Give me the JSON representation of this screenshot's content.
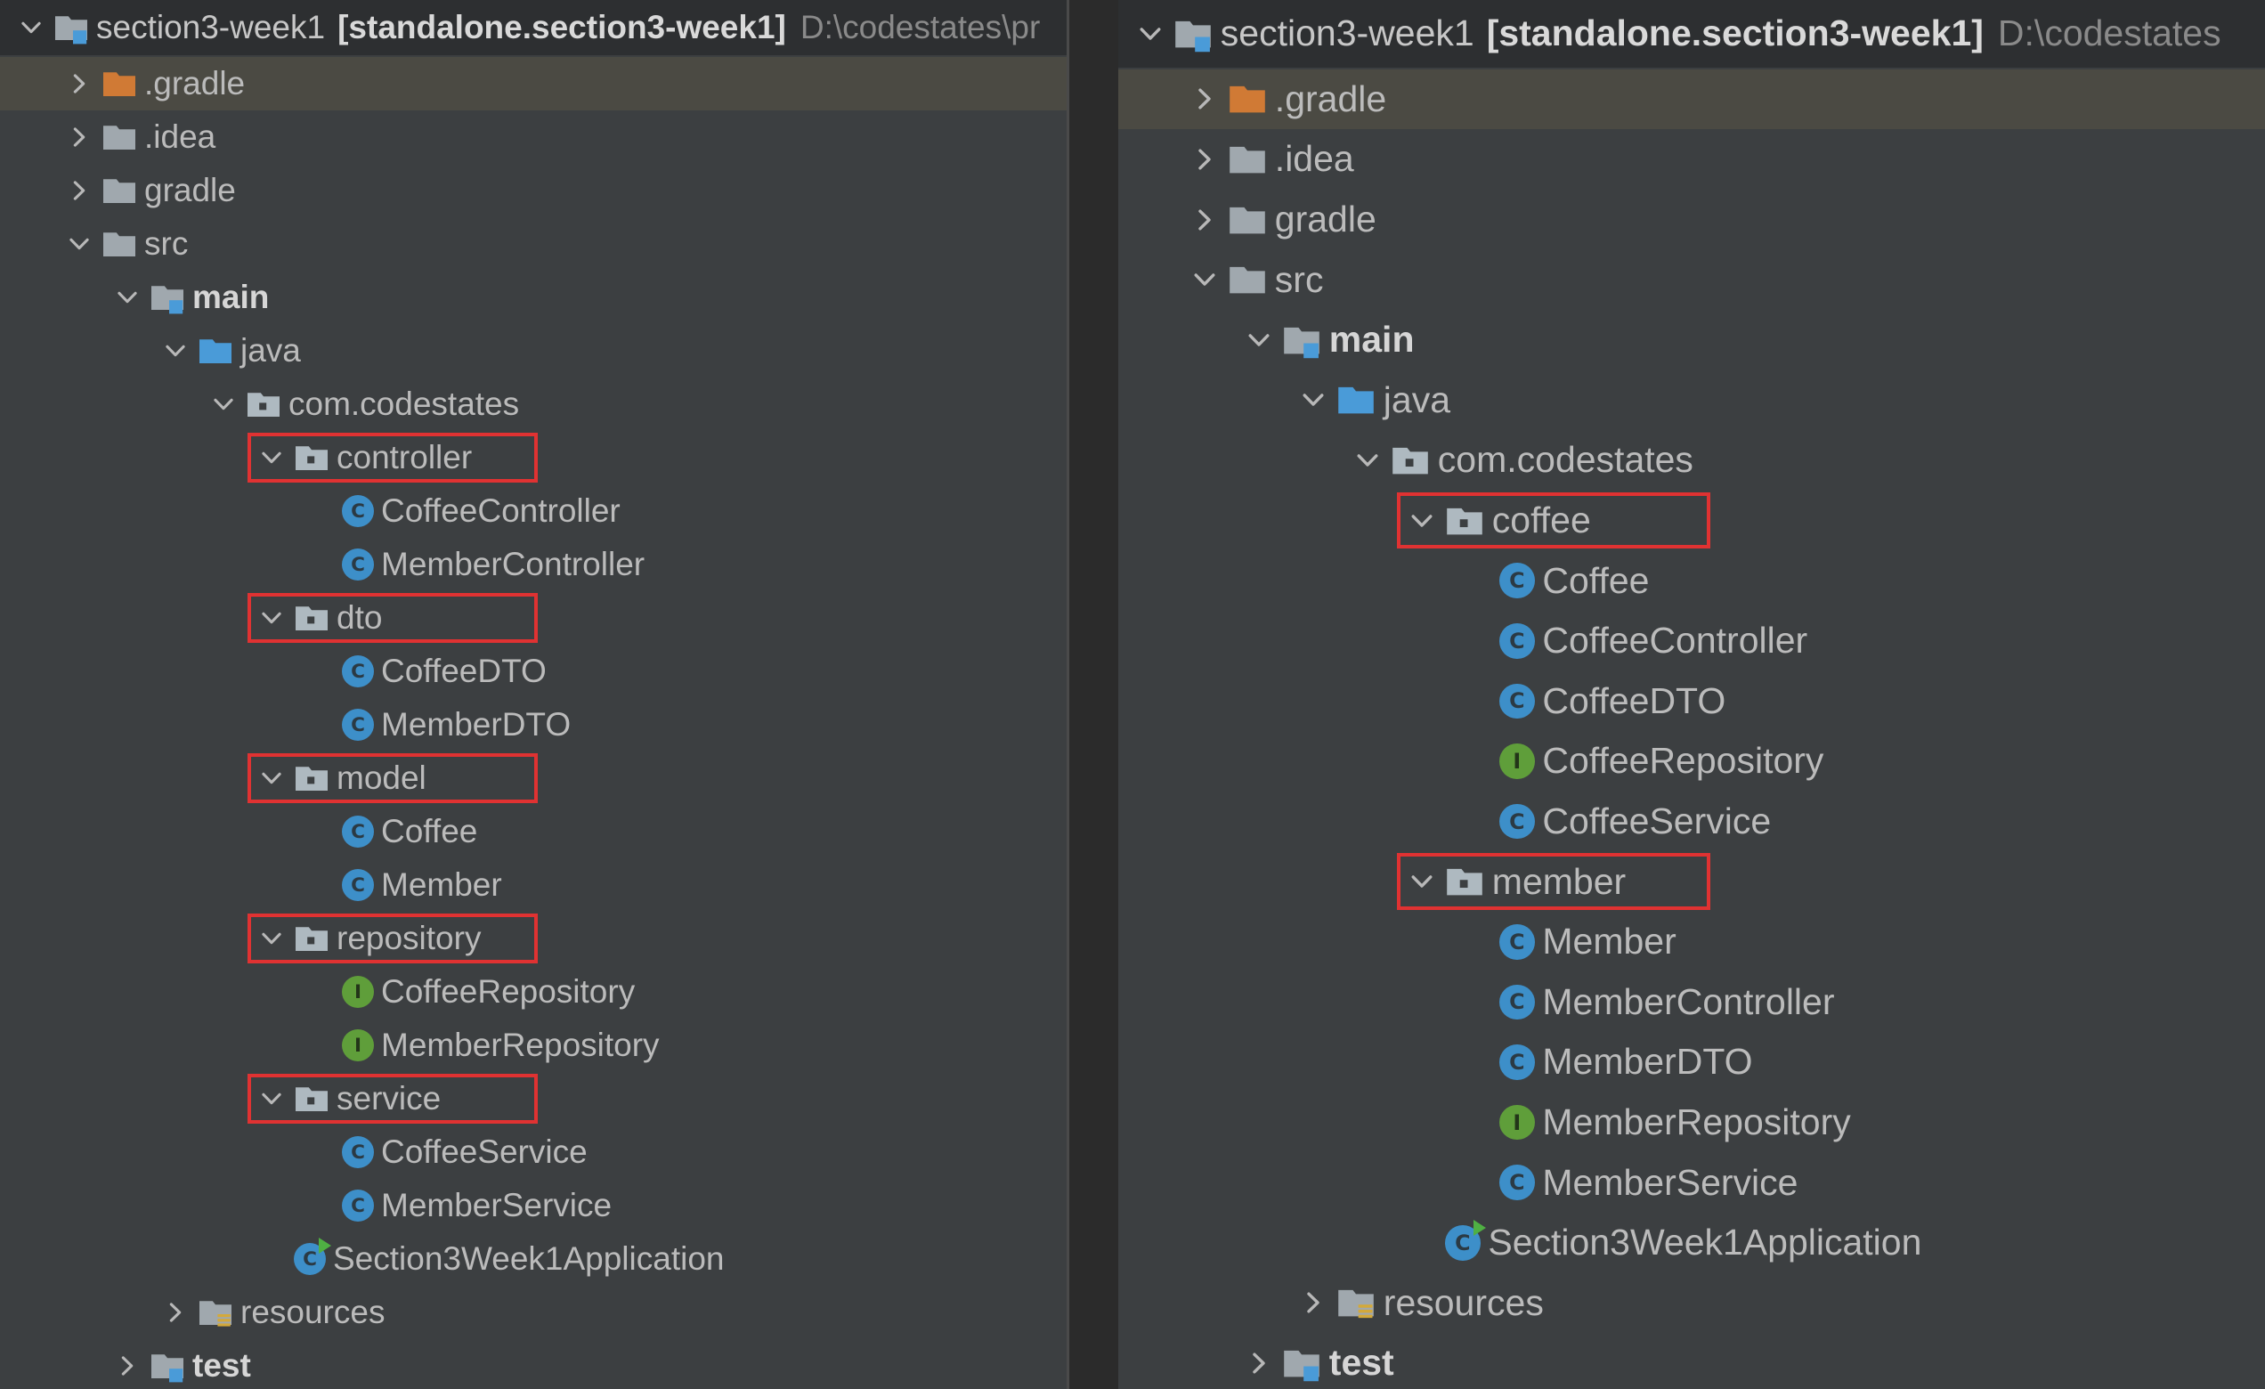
{
  "colors": {
    "panel_bg": "#3c3f41",
    "header_bg": "#2d2f31",
    "selected_row": "#4b4a43",
    "text": "#bbbbbb",
    "class_icon": "#3d8fc9",
    "interface_icon": "#5f9e3a",
    "gradle_folder": "#d07a35",
    "package_folder": "#aeb9c0",
    "source_folder": "#4a9bd8",
    "highlight_box": "#e03232"
  },
  "left": {
    "rows": [
      {
        "depth": 0,
        "chev": "down",
        "icon": "module-folder",
        "label": "section3-week1",
        "bold_suffix": "[standalone.section3-week1]",
        "path": "D:\\codestates\\pr",
        "header": true
      },
      {
        "depth": 1,
        "chev": "right",
        "icon": "gradle-folder-icon",
        "label": ".gradle",
        "hl": true
      },
      {
        "depth": 1,
        "chev": "right",
        "icon": "folder-icon",
        "label": ".idea"
      },
      {
        "depth": 1,
        "chev": "right",
        "icon": "folder-icon",
        "label": "gradle"
      },
      {
        "depth": 1,
        "chev": "down",
        "icon": "folder-icon",
        "label": "src"
      },
      {
        "depth": 2,
        "chev": "down",
        "icon": "module-folder-icon",
        "label": "main",
        "bold": true
      },
      {
        "depth": 3,
        "chev": "down",
        "icon": "source-folder-icon",
        "label": "java"
      },
      {
        "depth": 4,
        "chev": "down",
        "icon": "package-icon",
        "label": "com.codestates"
      },
      {
        "depth": 5,
        "chev": "down",
        "icon": "package-icon",
        "label": "controller",
        "box": true
      },
      {
        "depth": 6,
        "icon": "class-icon",
        "label": "CoffeeController"
      },
      {
        "depth": 6,
        "icon": "class-icon",
        "label": "MemberController"
      },
      {
        "depth": 5,
        "chev": "down",
        "icon": "package-icon",
        "label": "dto",
        "box": true
      },
      {
        "depth": 6,
        "icon": "class-icon",
        "label": "CoffeeDTO"
      },
      {
        "depth": 6,
        "icon": "class-icon",
        "label": "MemberDTO"
      },
      {
        "depth": 5,
        "chev": "down",
        "icon": "package-icon",
        "label": "model",
        "box": true
      },
      {
        "depth": 6,
        "icon": "class-icon",
        "label": "Coffee"
      },
      {
        "depth": 6,
        "icon": "class-icon",
        "label": "Member"
      },
      {
        "depth": 5,
        "chev": "down",
        "icon": "package-icon",
        "label": "repository",
        "box": true
      },
      {
        "depth": 6,
        "icon": "interface-icon",
        "label": "CoffeeRepository"
      },
      {
        "depth": 6,
        "icon": "interface-icon",
        "label": "MemberRepository"
      },
      {
        "depth": 5,
        "chev": "down",
        "icon": "package-icon",
        "label": "service",
        "box": true
      },
      {
        "depth": 6,
        "icon": "class-icon",
        "label": "CoffeeService"
      },
      {
        "depth": 6,
        "icon": "class-icon",
        "label": "MemberService"
      },
      {
        "depth": 5,
        "icon": "spring-app-icon",
        "label": "Section3Week1Application"
      },
      {
        "depth": 3,
        "chev": "right",
        "icon": "resources-folder-icon",
        "label": "resources"
      },
      {
        "depth": 2,
        "chev": "right",
        "icon": "module-folder-icon",
        "label": "test",
        "bold": true
      }
    ]
  },
  "right": {
    "rows": [
      {
        "depth": 0,
        "chev": "down",
        "icon": "module-folder",
        "label": "section3-week1",
        "bold_suffix": "[standalone.section3-week1]",
        "path": "D:\\codestates",
        "header": true
      },
      {
        "depth": 1,
        "chev": "right",
        "icon": "gradle-folder-icon",
        "label": ".gradle",
        "hl": true
      },
      {
        "depth": 1,
        "chev": "right",
        "icon": "folder-icon",
        "label": ".idea"
      },
      {
        "depth": 1,
        "chev": "right",
        "icon": "folder-icon",
        "label": "gradle"
      },
      {
        "depth": 1,
        "chev": "down",
        "icon": "folder-icon",
        "label": "src"
      },
      {
        "depth": 2,
        "chev": "down",
        "icon": "module-folder-icon",
        "label": "main",
        "bold": true
      },
      {
        "depth": 3,
        "chev": "down",
        "icon": "source-folder-icon",
        "label": "java"
      },
      {
        "depth": 4,
        "chev": "down",
        "icon": "package-icon",
        "label": "com.codestates"
      },
      {
        "depth": 5,
        "chev": "down",
        "icon": "package-icon",
        "label": "coffee",
        "box": true
      },
      {
        "depth": 6,
        "icon": "class-icon",
        "label": "Coffee"
      },
      {
        "depth": 6,
        "icon": "class-icon",
        "label": "CoffeeController"
      },
      {
        "depth": 6,
        "icon": "class-icon",
        "label": "CoffeeDTO"
      },
      {
        "depth": 6,
        "icon": "interface-icon",
        "label": "CoffeeRepository"
      },
      {
        "depth": 6,
        "icon": "class-icon",
        "label": "CoffeeService"
      },
      {
        "depth": 5,
        "chev": "down",
        "icon": "package-icon",
        "label": "member",
        "box": true
      },
      {
        "depth": 6,
        "icon": "class-icon",
        "label": "Member"
      },
      {
        "depth": 6,
        "icon": "class-icon",
        "label": "MemberController"
      },
      {
        "depth": 6,
        "icon": "class-icon",
        "label": "MemberDTO"
      },
      {
        "depth": 6,
        "icon": "interface-icon",
        "label": "MemberRepository"
      },
      {
        "depth": 6,
        "icon": "class-icon",
        "label": "MemberService"
      },
      {
        "depth": 5,
        "icon": "spring-app-icon",
        "label": "Section3Week1Application"
      },
      {
        "depth": 3,
        "chev": "right",
        "icon": "resources-folder-icon",
        "label": "resources"
      },
      {
        "depth": 2,
        "chev": "right",
        "icon": "module-folder-icon",
        "label": "test",
        "bold": true
      }
    ]
  }
}
